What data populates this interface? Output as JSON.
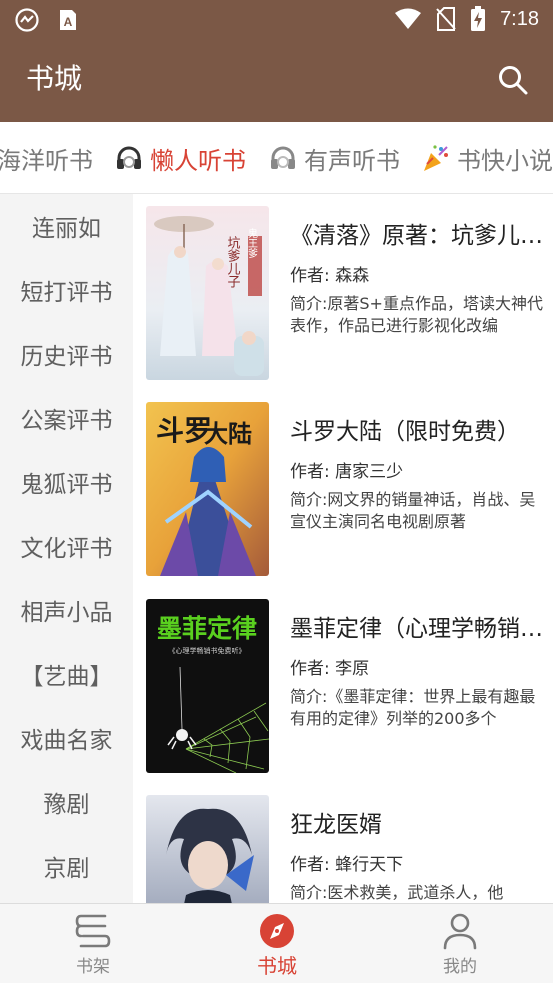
{
  "status_bar": {
    "time": "7:18",
    "icons": [
      "speed-icon",
      "a-icon",
      "wifi-icon",
      "no-sim-icon",
      "battery-charging-icon"
    ]
  },
  "app_bar": {
    "title": "书城",
    "icons": [
      "search-icon"
    ]
  },
  "source_tabs": [
    {
      "label": "海洋听书",
      "icon": "",
      "active": false
    },
    {
      "label": "懒人听书",
      "icon": "headphones-icon",
      "active": true
    },
    {
      "label": "有声听书",
      "icon": "headphones-icon",
      "active": false
    },
    {
      "label": "书快小说",
      "icon": "party-popper-icon",
      "active": false
    }
  ],
  "categories": [
    "连丽如",
    "短打评书",
    "历史评书",
    "公案评书",
    "鬼狐评书",
    "文化评书",
    "相声小品",
    "【艺曲】",
    "戏曲名家",
    "豫剧",
    "京剧"
  ],
  "books": [
    {
      "title": "《清落》原著：坑爹儿子鬼王爹",
      "author": "作者: 森森",
      "intro": "简介:原著S+重点作品，塔读大神代表作，作品已进行影视化改编",
      "cover_text": "坑爹儿子鬼王爹"
    },
    {
      "title": "斗罗大陆（限时免费）",
      "author": "作者: 唐家三少",
      "intro": "简介:网文界的销量神话，肖战、吴宣仪主演同名电视剧原著",
      "cover_text": "斗罗大陆"
    },
    {
      "title": "墨菲定律（心理学畅销书免费听）",
      "author": "作者: 李原",
      "intro": "简介:《墨菲定律：世界上最有趣最有用的定律》列举的200多个",
      "cover_text": "墨菲定律",
      "cover_subtext": "《心理学畅销书免费听》"
    },
    {
      "title": "狂龙医婿",
      "author": "作者: 蜂行天下",
      "intro": "简介:医术救美，武道杀人，他",
      "cover_text": ""
    }
  ],
  "bottom_nav": [
    {
      "label": "书架",
      "icon": "bookshelf-icon",
      "active": false
    },
    {
      "label": "书城",
      "icon": "compass-icon",
      "active": true
    },
    {
      "label": "我的",
      "icon": "person-icon",
      "active": false
    }
  ],
  "colors": {
    "primary": "#7b5846",
    "accent": "#d84335",
    "sidebar_bg": "#f4f4f4"
  }
}
